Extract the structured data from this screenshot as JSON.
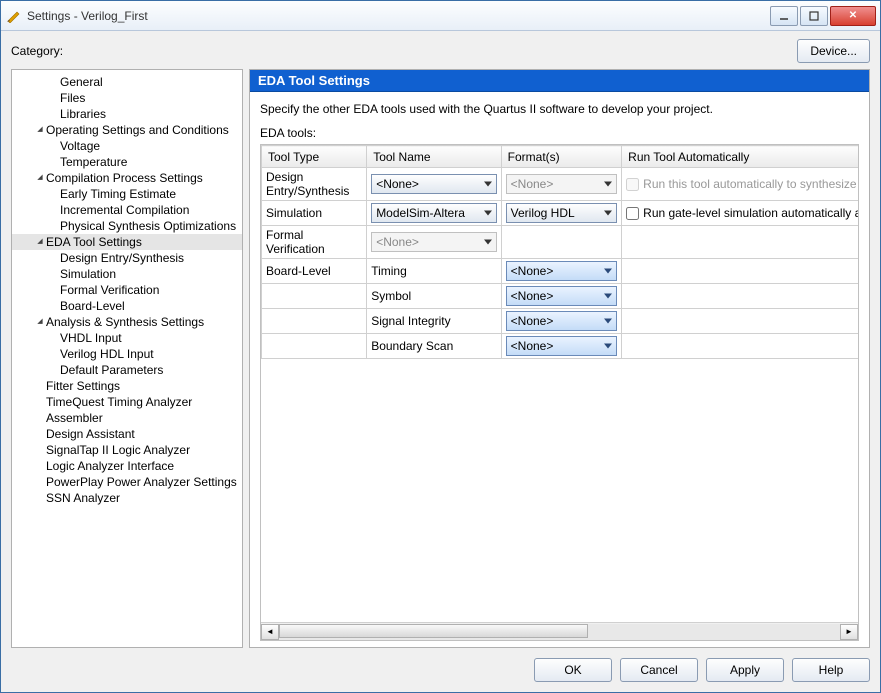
{
  "window": {
    "title": "Settings - Verilog_First"
  },
  "top": {
    "category_label": "Category:",
    "device_btn": "Device..."
  },
  "tree": [
    {
      "label": "General",
      "depth": 2
    },
    {
      "label": "Files",
      "depth": 2
    },
    {
      "label": "Libraries",
      "depth": 2
    },
    {
      "label": "Operating Settings and Conditions",
      "depth": 1,
      "twisty": "▾"
    },
    {
      "label": "Voltage",
      "depth": 2
    },
    {
      "label": "Temperature",
      "depth": 2
    },
    {
      "label": "Compilation Process Settings",
      "depth": 1,
      "twisty": "▾"
    },
    {
      "label": "Early Timing Estimate",
      "depth": 2
    },
    {
      "label": "Incremental Compilation",
      "depth": 2
    },
    {
      "label": "Physical Synthesis Optimizations",
      "depth": 2
    },
    {
      "label": "EDA Tool Settings",
      "depth": 1,
      "twisty": "▾",
      "selected": true
    },
    {
      "label": "Design Entry/Synthesis",
      "depth": 2
    },
    {
      "label": "Simulation",
      "depth": 2
    },
    {
      "label": "Formal Verification",
      "depth": 2
    },
    {
      "label": "Board-Level",
      "depth": 2
    },
    {
      "label": "Analysis & Synthesis Settings",
      "depth": 1,
      "twisty": "▾"
    },
    {
      "label": "VHDL Input",
      "depth": 2
    },
    {
      "label": "Verilog HDL Input",
      "depth": 2
    },
    {
      "label": "Default Parameters",
      "depth": 2
    },
    {
      "label": "Fitter Settings",
      "depth": 1
    },
    {
      "label": "TimeQuest Timing Analyzer",
      "depth": 1
    },
    {
      "label": "Assembler",
      "depth": 1
    },
    {
      "label": "Design Assistant",
      "depth": 1
    },
    {
      "label": "SignalTap II Logic Analyzer",
      "depth": 1
    },
    {
      "label": "Logic Analyzer Interface",
      "depth": 1
    },
    {
      "label": "PowerPlay Power Analyzer Settings",
      "depth": 1
    },
    {
      "label": "SSN Analyzer",
      "depth": 1
    }
  ],
  "panel": {
    "header": "EDA Tool Settings",
    "description": "Specify the other EDA tools used with the Quartus II software to develop your project.",
    "subheader": "EDA tools:",
    "columns": {
      "type": "Tool Type",
      "name": "Tool Name",
      "format": "Format(s)",
      "auto": "Run Tool Automatically"
    },
    "rows": {
      "r0": {
        "type": "Design Entry/Synthesis",
        "name": "<None>",
        "format": "<None>",
        "auto_label": "Run this tool automatically to synthesize the current design"
      },
      "r1": {
        "type": "Simulation",
        "name": "ModelSim-Altera",
        "format": "Verilog HDL",
        "auto_label": "Run gate-level simulation automatically after compilation"
      },
      "r2": {
        "type": "Formal Verification",
        "name": "<None>"
      },
      "r3": {
        "type": "Board-Level",
        "name": "Timing",
        "format": "<None>"
      },
      "r4": {
        "name": "Symbol",
        "format": "<None>"
      },
      "r5": {
        "name": "Signal Integrity",
        "format": "<None>"
      },
      "r6": {
        "name": "Boundary Scan",
        "format": "<None>"
      }
    }
  },
  "buttons": {
    "ok": "OK",
    "cancel": "Cancel",
    "apply": "Apply",
    "help": "Help"
  }
}
